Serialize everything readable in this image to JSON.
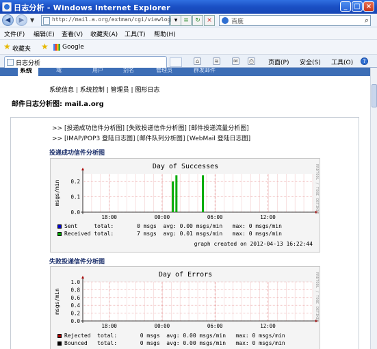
{
  "window": {
    "title": "日志分析 - Windows Internet Explorer"
  },
  "address": {
    "url": "http://mail.a.org/extman/cgi/viewlog.c",
    "search_placeholder": "百度"
  },
  "menubar": [
    "文件(F)",
    "编辑(E)",
    "查看(V)",
    "收藏夹(A)",
    "工具(T)",
    "帮助(H)"
  ],
  "favorites": {
    "label": "收藏夹",
    "google": "Google"
  },
  "tab": {
    "label": "日志分析"
  },
  "command_bar": {
    "page": "页面(P)",
    "safety": "安全(S)",
    "tools": "工具(O)"
  },
  "nav": {
    "items": [
      "系统",
      "域",
      "用户",
      "别名",
      "管理员",
      "群发邮件"
    ]
  },
  "sublinks": [
    "系统信息",
    "系统控制",
    "管理员",
    "图形日志"
  ],
  "page_heading": "邮件日志分析图: mail.a.org",
  "links": {
    "row1": [
      "投递成功信件分析图",
      "失败投递信件分析图",
      "邮件投递流量分析图"
    ],
    "row2": [
      "IMAP/POP3 登陆日志图",
      "邮件队列分析图",
      "WebMail 登陆日志图"
    ]
  },
  "sections": {
    "success_title": "投递成功信件分析图",
    "errors_title": "失败投递信件分析图"
  },
  "chart_data": [
    {
      "type": "line",
      "title": "Day of Successes",
      "ylabel": "msgs/min",
      "x_ticks": [
        "18:00",
        "00:00",
        "06:00",
        "12:00"
      ],
      "y_ticks": [
        "0.0",
        "0.1",
        "0.2"
      ],
      "ylim": [
        0,
        0.25
      ],
      "series": [
        {
          "name": "Sent",
          "color": "#0000cc",
          "values": []
        },
        {
          "name": "Received",
          "color": "#00aa00",
          "spikes": [
            {
              "x": 10.15,
              "y": 0.2
            },
            {
              "x": 10.55,
              "y": 0.24
            },
            {
              "x": 13.55,
              "y": 0.24
            }
          ]
        }
      ],
      "legend": [
        "Sent     total:       0 msgs  avg: 0.00 msgs/min   max: 0 msgs/min",
        "Received total:       7 msgs  avg: 0.01 msgs/min   max: 0 msgs/min"
      ],
      "created": "graph created on 2012-04-13 16:22:44",
      "side_text": "RRDTOOL / TOBI OETIKER"
    },
    {
      "type": "line",
      "title": "Day of Errors",
      "ylabel": "msgs/min",
      "x_ticks": [
        "18:00",
        "00:00",
        "06:00",
        "12:00"
      ],
      "y_ticks": [
        "0.0",
        "0.2",
        "0.4",
        "0.6",
        "0.8",
        "1.0"
      ],
      "ylim": [
        0,
        1.0
      ],
      "series": [
        {
          "name": "Rejected",
          "color": "#aa0000",
          "values": []
        },
        {
          "name": "Bounced",
          "color": "#000000",
          "values": []
        }
      ],
      "legend": [
        "Rejected  total:       0 msgs  avg: 0.00 msgs/min   max: 0 msgs/min",
        "Bounced   total:       0 msgs  avg: 0.00 msgs/min   max: 0 msgs/min"
      ],
      "side_text": "RRDTOOL / TOBI OETIKER"
    }
  ]
}
